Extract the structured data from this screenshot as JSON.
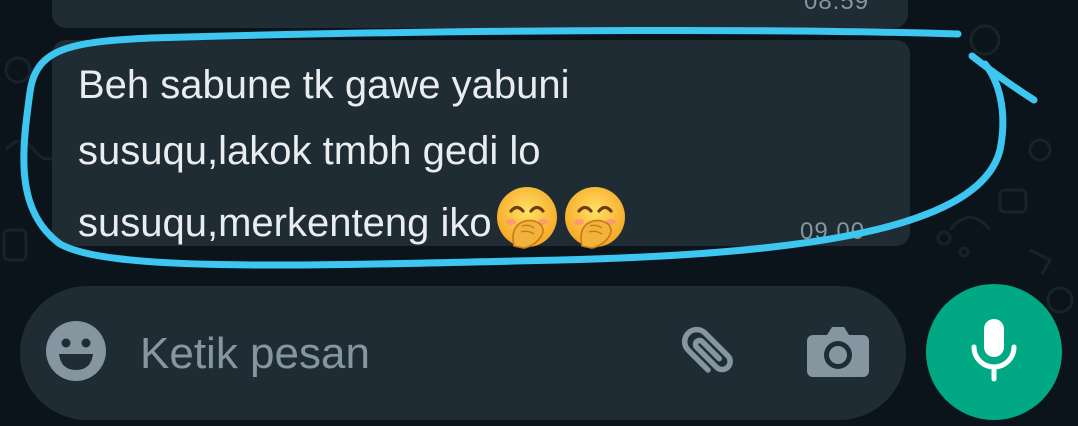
{
  "chat": {
    "previous_message": {
      "time": "08.59"
    },
    "message": {
      "text": "Beh sabune tk gawe yabuni susuqu,lakok tmbh gedi lo susuqu,merkenteng iko",
      "emojis": [
        "face-with-hand-over-mouth",
        "face-with-hand-over-mouth"
      ],
      "time": "09.00"
    }
  },
  "composer": {
    "placeholder": "Ketik pesan",
    "value": "",
    "icons": {
      "emoji": "smiley-icon",
      "attach": "paperclip-icon",
      "camera": "camera-icon",
      "mic": "microphone-icon"
    }
  },
  "colors": {
    "background": "#0b141a",
    "bubble": "#1f2c34",
    "message_text": "#e9edef",
    "secondary_text": "#8696a0",
    "accent": "#00a884",
    "annotation": "#3cc6f0"
  }
}
